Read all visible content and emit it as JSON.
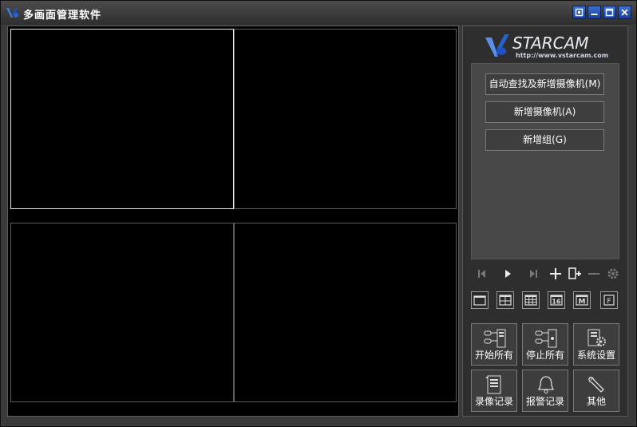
{
  "window": {
    "title": "多画面管理软件",
    "controls": [
      "restore-icon",
      "minimize-icon",
      "maximize-icon",
      "close-icon"
    ]
  },
  "video_grid": {
    "layout": "2x2",
    "selected_cell": 1
  },
  "panel": {
    "brand": {
      "name": "VSTARCAM",
      "url": "http://www.vstarcam.com"
    },
    "actions": [
      {
        "label": "自动查找及新增摄像机(M)"
      },
      {
        "label": "新增摄像机(A)"
      },
      {
        "label": "新增组(G)"
      }
    ],
    "playback_controls": [
      "first-icon",
      "play-icon",
      "last-icon",
      "add-icon",
      "add-device-icon",
      "remove-icon",
      "settings-gear-icon"
    ],
    "layout_buttons": [
      "layout-1-icon",
      "layout-4-icon",
      "layout-9-icon",
      "layout-16-icon",
      "layout-m-icon",
      "layout-full-icon"
    ],
    "layout_labels": {
      "sixteen": "16",
      "m": "M",
      "f": "F"
    },
    "tools": [
      {
        "label": "开始所有"
      },
      {
        "label": "停止所有"
      },
      {
        "label": "系统设置"
      },
      {
        "label": "录像记录"
      },
      {
        "label": "报警记录"
      },
      {
        "label": "其他"
      }
    ]
  },
  "colors": {
    "titlebar_button": "#2b55c0",
    "background": "#3a3a3a",
    "video_bg": "#000000",
    "selected_border": "#e6e6e6"
  }
}
